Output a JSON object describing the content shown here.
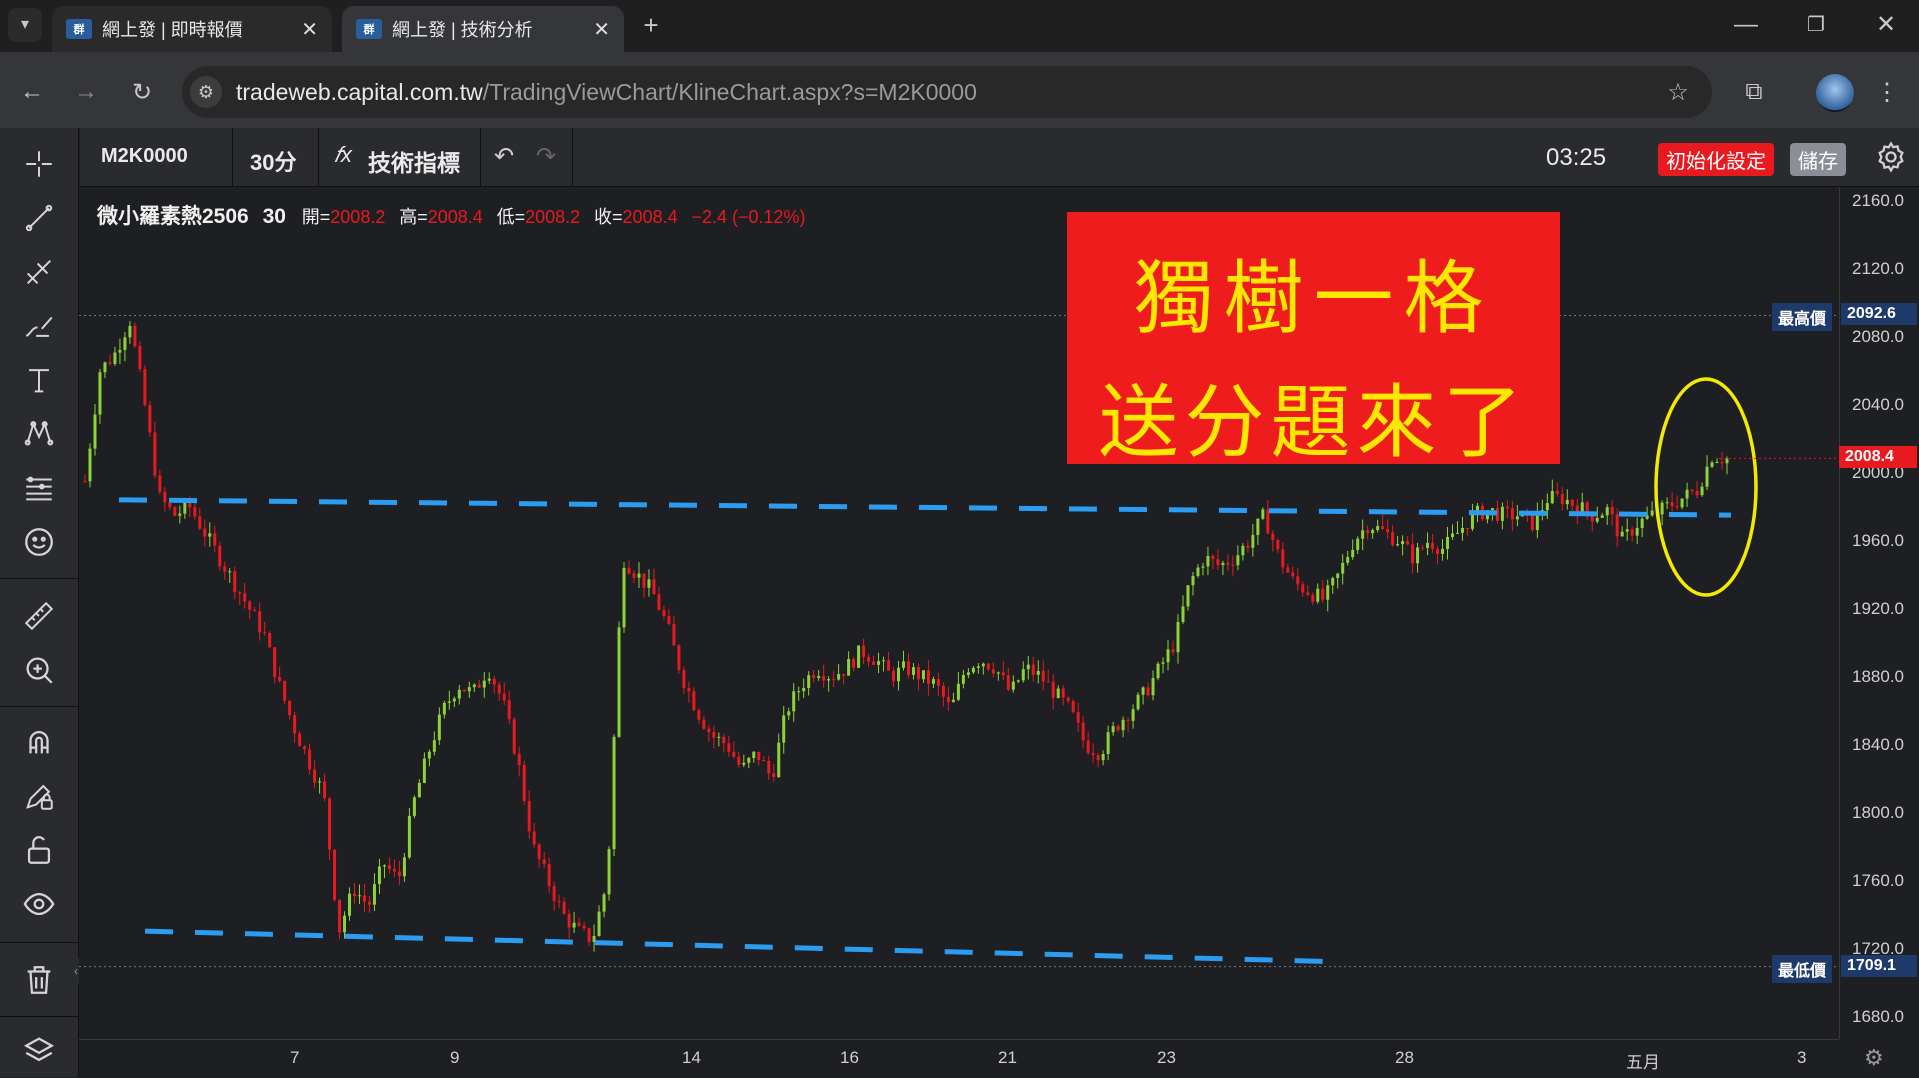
{
  "browser": {
    "tabs": [
      {
        "title": "網上發 | 即時報價",
        "favicon": "capital-logo",
        "active": false
      },
      {
        "title": "網上發 | 技術分析",
        "favicon": "capital-logo",
        "active": true
      }
    ],
    "url_host": "tradeweb.capital.com.tw",
    "url_path": "/TradingViewChart/KlineChart.aspx?s=M2K0000"
  },
  "toolbar": {
    "symbol": "M2K0000",
    "interval": "30分",
    "indicators_label": "技術指標",
    "time": "03:25",
    "reset_label": "初始化設定",
    "save_label": "儲存"
  },
  "legend": {
    "name": "微小羅素熱2506",
    "interval": "30",
    "open_label": "開=",
    "open": "2008.2",
    "high_label": "高=",
    "high": "2008.4",
    "low_label": "低=",
    "low": "2008.2",
    "close_label": "收=",
    "close": "2008.4",
    "change": "−2.4 (−0.12%)"
  },
  "annotation": {
    "line1": "獨樹一格",
    "line2": "送分題來了"
  },
  "price_axis": {
    "ticks": [
      "2160.0",
      "2120.0",
      "2080.0",
      "2040.0",
      "2000.0",
      "1960.0",
      "1920.0",
      "1880.0",
      "1840.0",
      "1800.0",
      "1760.0",
      "1720.0",
      "1680.0"
    ],
    "current_price": "2008.4",
    "high_label": "最高價",
    "high_value": "2092.6",
    "low_label": "最低價",
    "low_value": "1709.1"
  },
  "time_axis": {
    "ticks": [
      "7",
      "9",
      "14",
      "16",
      "21",
      "23",
      "28",
      "五月",
      "3"
    ]
  },
  "colors": {
    "up": "#8cd23a",
    "down": "#e8191f",
    "price_tag": "#e8191f",
    "extreme_tag": "#1d3a6b",
    "trendline": "#2c9cf2",
    "circle": "#f3ea00",
    "promo_bg": "#ee1c1c",
    "promo_text": "#ffe700"
  },
  "chart_data": {
    "type": "candlestick",
    "symbol": "微小羅素熱2506",
    "interval": "30",
    "ylim": [
      1670,
      2170
    ],
    "y_ticks": [
      2160,
      2120,
      2080,
      2040,
      2000,
      1960,
      1920,
      1880,
      1840,
      1800,
      1760,
      1720,
      1680
    ],
    "x_ticks": [
      "7",
      "9",
      "14",
      "16",
      "21",
      "23",
      "28",
      "五月",
      "3"
    ],
    "last": {
      "open": 2008.2,
      "high": 2008.4,
      "low": 2008.2,
      "close": 2008.4,
      "change": -2.4,
      "change_pct": -0.12
    },
    "highest": 2092.6,
    "lowest": 1709.1,
    "series": [
      {
        "name": "path",
        "values": [
          1995,
          2060,
          2070,
          2090,
          2040,
          1985,
          1975,
          1980,
          1965,
          1950,
          1935,
          1920,
          1905,
          1875,
          1850,
          1830,
          1810,
          1730,
          1755,
          1745,
          1770,
          1760,
          1805,
          1835,
          1860,
          1875,
          1870,
          1885,
          1865,
          1830,
          1780,
          1760,
          1740,
          1730,
          1725,
          1760,
          1950,
          1940,
          1930,
          1910,
          1880,
          1860,
          1845,
          1840,
          1825,
          1835,
          1820,
          1860,
          1875,
          1885,
          1880,
          1885,
          1895,
          1890,
          1880,
          1885,
          1880,
          1875,
          1860,
          1885,
          1890,
          1885,
          1870,
          1885,
          1880,
          1870,
          1860,
          1840,
          1835,
          1850,
          1860,
          1870,
          1885,
          1900,
          1935,
          1950,
          1945,
          1950,
          1960,
          1975,
          1950,
          1935,
          1930,
          1925,
          1940,
          1960,
          1970,
          1965,
          1960,
          1950,
          1960,
          1955,
          1965,
          1975,
          1978,
          1975,
          1975,
          1970,
          1985,
          1985,
          1980,
          1975,
          1978,
          1960,
          1970,
          1975,
          1980,
          1985,
          1990,
          2010,
          2008
        ]
      }
    ],
    "trendlines": [
      {
        "name": "upper",
        "from": 1984,
        "to": 1975
      },
      {
        "name": "lower",
        "from": 1730,
        "to": 1712
      }
    ]
  }
}
